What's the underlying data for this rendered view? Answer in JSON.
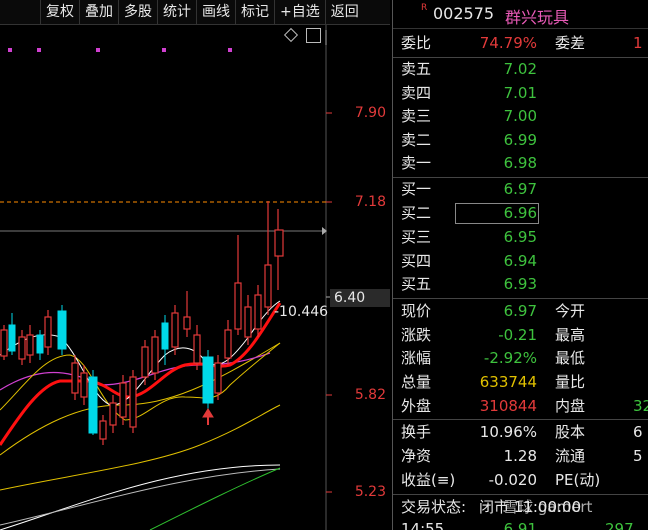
{
  "toolbar": {
    "buttons": [
      "复权",
      "叠加",
      "多股",
      "统计",
      "画线",
      "标记",
      "+自选",
      "返回"
    ]
  },
  "chart": {
    "price_ticks": [
      "7.90",
      "7.18",
      "5.82",
      "5.23"
    ],
    "current_tick": "6.40",
    "ma_label": "-10.446",
    "colors": {
      "up": "#e23a3a",
      "down": "#00d8e8",
      "ma5": "#ffffff",
      "ma10": "#e0c000",
      "ma20": "#d040d0",
      "ma_red": "#ff1010",
      "dashed": "#ff8c00"
    }
  },
  "panel": {
    "r_mark": "R",
    "code": "002575",
    "name": "群兴玩具",
    "weibi_label": "委比",
    "weibi_value": "74.79%",
    "weicha_label": "委差",
    "weicha_value": "1",
    "sell": [
      {
        "label": "卖五",
        "price": "7.02"
      },
      {
        "label": "卖四",
        "price": "7.01"
      },
      {
        "label": "卖三",
        "price": "7.00"
      },
      {
        "label": "卖二",
        "price": "6.99"
      },
      {
        "label": "卖一",
        "price": "6.98"
      }
    ],
    "buy": [
      {
        "label": "买一",
        "price": "6.97"
      },
      {
        "label": "买二",
        "price": "6.96"
      },
      {
        "label": "买三",
        "price": "6.95"
      },
      {
        "label": "买四",
        "price": "6.94"
      },
      {
        "label": "买五",
        "price": "6.93"
      }
    ],
    "stats": {
      "xianjia": {
        "label": "现价",
        "value": "6.97"
      },
      "jinkai": {
        "label": "今开"
      },
      "zhangdie": {
        "label": "涨跌",
        "value": "-0.21"
      },
      "zuigao": {
        "label": "最高"
      },
      "zhangfu": {
        "label": "涨幅",
        "value": "-2.92%"
      },
      "zuidi": {
        "label": "最低"
      },
      "zongliang": {
        "label": "总量",
        "value": "633744"
      },
      "liangbi": {
        "label": "量比"
      },
      "waipan": {
        "label": "外盘",
        "value": "310844"
      },
      "neipan": {
        "label": "内盘",
        "value": "32"
      },
      "huanshou": {
        "label": "换手",
        "value": "10.96%"
      },
      "guben": {
        "label": "股本",
        "value": "6"
      },
      "jingzi": {
        "label": "净资",
        "value": "1.28"
      },
      "liutong": {
        "label": "流通",
        "value": "5"
      },
      "shouyi": {
        "label": "收益(≡)",
        "value": "-0.020"
      },
      "pe": {
        "label": "PE(动)"
      },
      "status": {
        "label": "交易状态:",
        "value": "闭市   11:00:00"
      },
      "last_time": "14:55",
      "last_price": "6.91",
      "last_vol": "297"
    },
    "watermark": "雪球 gamert"
  }
}
